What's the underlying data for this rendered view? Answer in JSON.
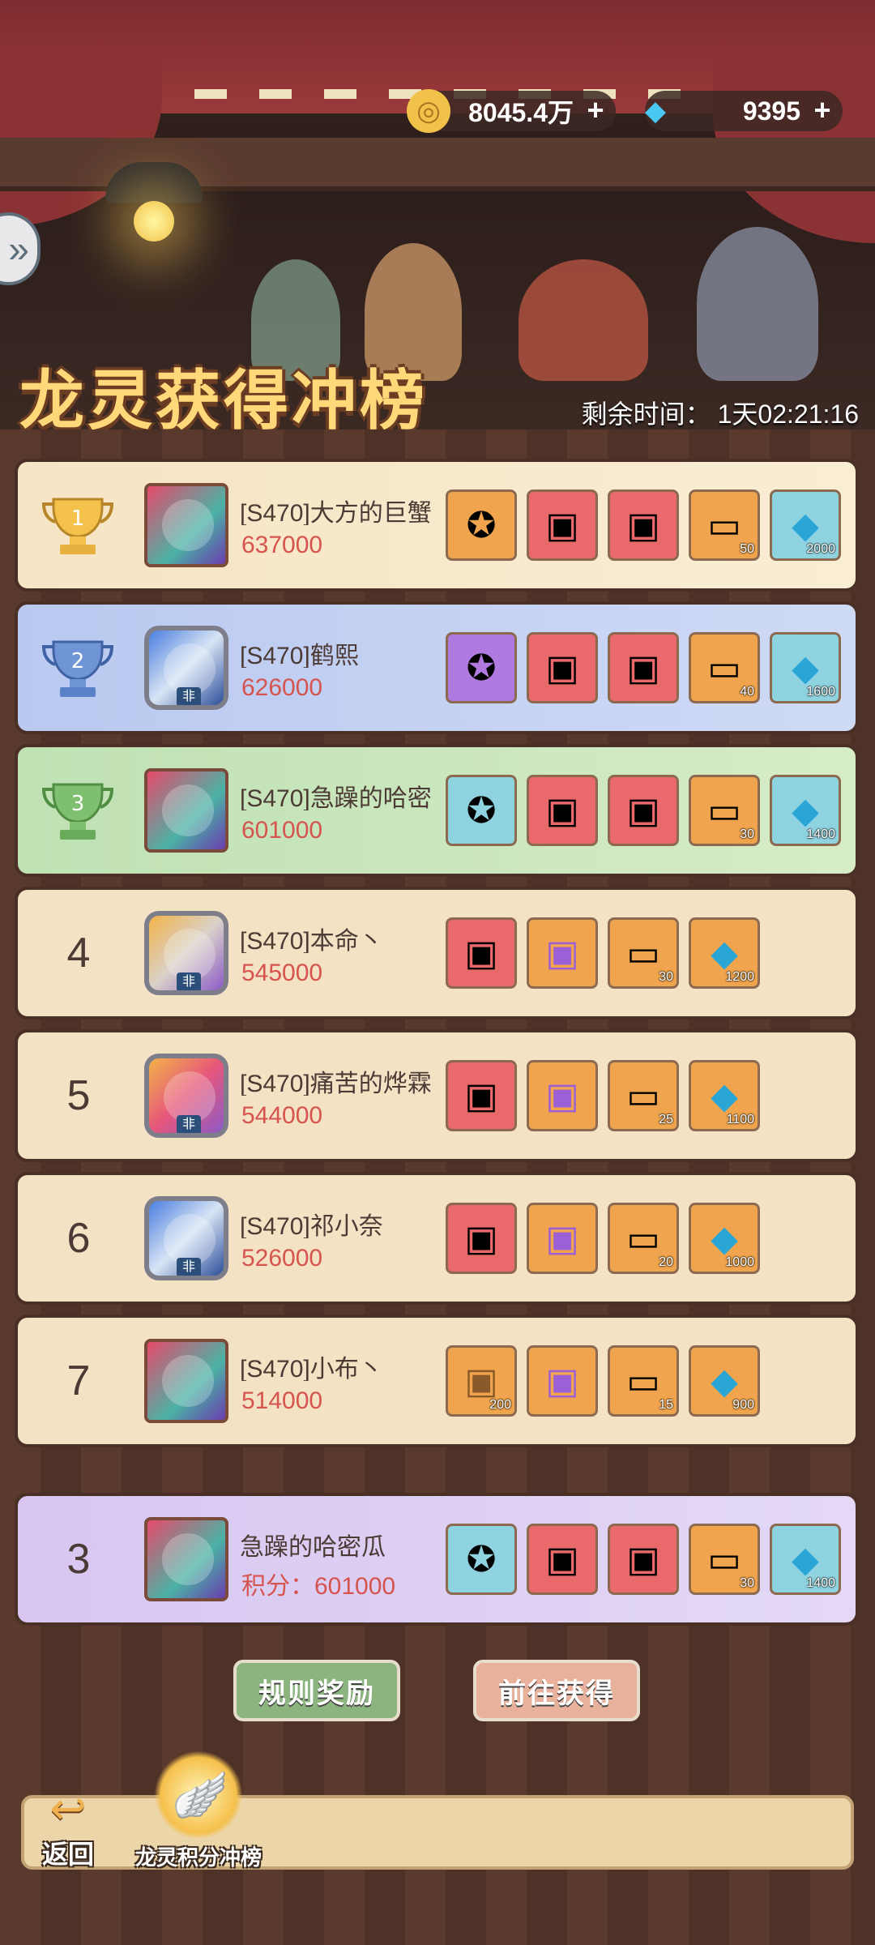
{
  "currency": {
    "gold": {
      "icon": "gold-coin-icon",
      "value": "8045.4万"
    },
    "diamond": {
      "icon": "diamond-icon",
      "value": "9395"
    }
  },
  "header": {
    "title": "龙灵获得冲榜",
    "timer_label": "剩余时间：",
    "timer_value": "1天02:21:16"
  },
  "ranking": [
    {
      "rank": "1",
      "name": "[S470]大方的巨蟹",
      "score": "637000",
      "rewards": [
        {
          "icon": "orange-spirit-icon"
        },
        {
          "icon": "red-chest-icon"
        },
        {
          "icon": "red-purple-chest-icon"
        },
        {
          "icon": "ticket-icon",
          "count": "50"
        },
        {
          "icon": "diamond-icon",
          "count": "2000"
        }
      ]
    },
    {
      "rank": "2",
      "name": "[S470]鹤熙",
      "score": "626000",
      "rewards": [
        {
          "icon": "purple-spirit-icon"
        },
        {
          "icon": "gold-chest-icon"
        },
        {
          "icon": "red-purple-chest-icon"
        },
        {
          "icon": "ticket-icon",
          "count": "40"
        },
        {
          "icon": "diamond-icon",
          "count": "1600"
        }
      ]
    },
    {
      "rank": "3",
      "name": "[S470]急躁的哈密",
      "score": "601000",
      "rewards": [
        {
          "icon": "cyan-spirit-icon"
        },
        {
          "icon": "red-chest-icon"
        },
        {
          "icon": "red-purple-chest-icon"
        },
        {
          "icon": "ticket-icon",
          "count": "30"
        },
        {
          "icon": "diamond-icon",
          "count": "1400"
        }
      ]
    },
    {
      "rank": "4",
      "name": "[S470]本命丶",
      "score": "545000",
      "rewards": [
        {
          "icon": "red-chest-icon"
        },
        {
          "icon": "purple-chest-icon"
        },
        {
          "icon": "ticket-icon",
          "count": "30"
        },
        {
          "icon": "diamond-icon",
          "count": "1200"
        }
      ]
    },
    {
      "rank": "5",
      "name": "[S470]痛苦的烨霖",
      "score": "544000",
      "rewards": [
        {
          "icon": "gold-chest-icon"
        },
        {
          "icon": "purple-chest-icon"
        },
        {
          "icon": "ticket-icon",
          "count": "25"
        },
        {
          "icon": "diamond-icon",
          "count": "1100"
        }
      ]
    },
    {
      "rank": "6",
      "name": "[S470]祁小奈",
      "score": "526000",
      "rewards": [
        {
          "icon": "red-chest-icon"
        },
        {
          "icon": "purple-chest-icon"
        },
        {
          "icon": "ticket-icon",
          "count": "20"
        },
        {
          "icon": "diamond-icon",
          "count": "1000"
        }
      ]
    },
    {
      "rank": "7",
      "name": "[S470]小布丶",
      "score": "514000",
      "rewards": [
        {
          "icon": "wood-chest-icon",
          "count": "200"
        },
        {
          "icon": "purple-chest-icon"
        },
        {
          "icon": "ticket-icon",
          "count": "15"
        },
        {
          "icon": "diamond-icon",
          "count": "900"
        }
      ]
    }
  ],
  "my_rank": {
    "rank": "3",
    "name": "急躁的哈密瓜",
    "score_label": "积分：",
    "score": "601000",
    "rewards": [
      {
        "icon": "cyan-spirit-icon"
      },
      {
        "icon": "red-chest-icon"
      },
      {
        "icon": "red-purple-chest-icon"
      },
      {
        "icon": "ticket-icon",
        "count": "30"
      },
      {
        "icon": "diamond-icon",
        "count": "1400"
      }
    ]
  },
  "buttons": {
    "rules": "规则奖励",
    "go": "前往获得"
  },
  "nav": {
    "back": "返回",
    "tab": "龙灵积分冲榜"
  }
}
